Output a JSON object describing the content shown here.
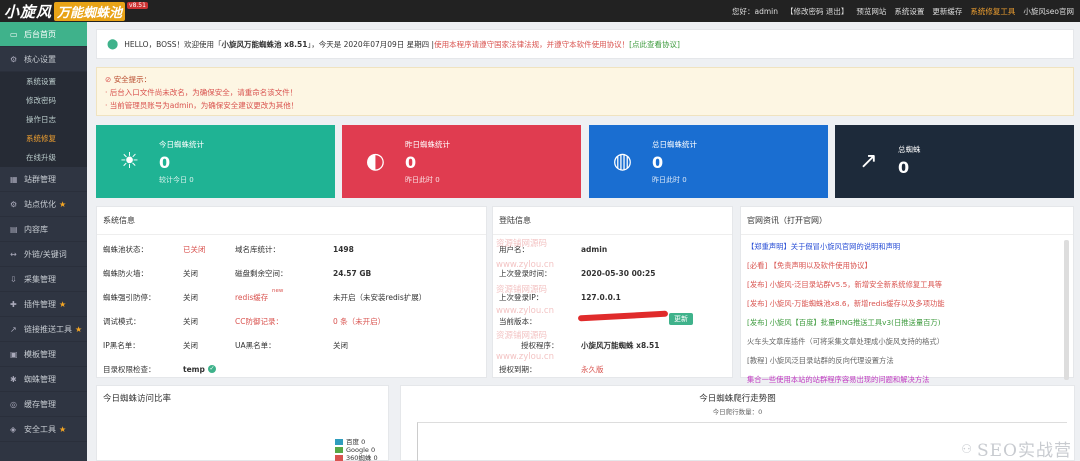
{
  "app": {
    "logo_main": "小旋风",
    "logo_badge": "万能蜘蛛池",
    "logo_version": "v8.51"
  },
  "topbar": {
    "links": [
      {
        "label": "您好：admin"
      },
      {
        "label": "【修改密码 退出】"
      },
      {
        "label": "预览网站"
      },
      {
        "label": "系统设置"
      },
      {
        "label": "更新缓存"
      },
      {
        "label": "系统修复工具",
        "highlight": true
      },
      {
        "label": "小旋风seo官网"
      }
    ]
  },
  "sidebar": {
    "items": [
      {
        "label": "后台首页",
        "icon": "home-icon",
        "glyph": "▭",
        "active": true
      },
      {
        "label": "核心设置",
        "icon": "gear-icon",
        "glyph": "⚙",
        "expanded": true,
        "children": [
          {
            "label": "系统设置"
          },
          {
            "label": "修改密码"
          },
          {
            "label": "操作日志"
          },
          {
            "label": "系统修复",
            "active": true
          },
          {
            "label": "在线升级"
          }
        ]
      },
      {
        "label": "站群管理",
        "icon": "sites-icon",
        "glyph": "▦"
      },
      {
        "label": "站点优化",
        "icon": "optimize-icon",
        "glyph": "⚙",
        "star": true
      },
      {
        "label": "内容库",
        "icon": "database-icon",
        "glyph": "▤"
      },
      {
        "label": "外链/关键词",
        "icon": "link-icon",
        "glyph": "↔"
      },
      {
        "label": "采集管理",
        "icon": "collect-icon",
        "glyph": "⇩"
      },
      {
        "label": "插件管理",
        "icon": "plugin-icon",
        "glyph": "✚",
        "star": true
      },
      {
        "label": "链接推送工具",
        "icon": "push-icon",
        "glyph": "↗",
        "star": true
      },
      {
        "label": "模板管理",
        "icon": "template-icon",
        "glyph": "▣"
      },
      {
        "label": "蜘蛛管理",
        "icon": "spider-icon",
        "glyph": "✱"
      },
      {
        "label": "缓存管理",
        "icon": "cache-icon",
        "glyph": "◎"
      },
      {
        "label": "安全工具",
        "icon": "shield-icon",
        "glyph": "◈",
        "star": true
      }
    ]
  },
  "welcome": {
    "prefix": "HELLO，BOSS！欢迎使用「",
    "product": "小旋风万能蜘蛛池 x8.51",
    "middle": "」，今天是 2020年07月09日 星期四 | ",
    "warning": "使用本程序请遵守国家法律法规，并遵守本软件使用协议！",
    "link": "[点此查看协议]"
  },
  "alert": {
    "title": "安全提示：",
    "lines": [
      "· 后台入口文件尚未改名，为确保安全，请重命名该文件！",
      "· 当前管理员账号为admin，为确保安全建议更改为其他！"
    ]
  },
  "stats": [
    {
      "title": "今日蜘蛛统计",
      "value": "0",
      "sub": "较计今日 0",
      "color": "#1fb394",
      "icon": "sun-icon",
      "glyph": "☀"
    },
    {
      "title": "昨日蜘蛛统计",
      "value": "0",
      "sub": "昨日此时 0",
      "color": "#e03c50",
      "icon": "contrast-icon",
      "glyph": "◐"
    },
    {
      "title": "总日蜘蛛统计",
      "value": "0",
      "sub": "昨日此时 0",
      "color": "#1a6ed1",
      "icon": "globe-icon",
      "glyph": "◍"
    },
    {
      "title": "总蜘蛛",
      "value": "0",
      "sub": "",
      "color": "#1d2a3a",
      "icon": "trend-icon",
      "glyph": "↗"
    }
  ],
  "system": {
    "title": "系统信息",
    "rows": [
      {
        "l1": "蜘蛛池状态：",
        "v1": "已关闭",
        "v1red": true,
        "l2": "域名库统计：",
        "v2": "1498"
      },
      {
        "l1": "蜘蛛防火墙：",
        "v1": "关闭",
        "l2": "磁盘剩余空间：",
        "v2": "24.57 GB"
      },
      {
        "l1": "蜘蛛强引防停：",
        "v1": "关闭",
        "l2": "redis缓存",
        "l2new": "new",
        "v2": "未开启（未安装redis扩展）"
      },
      {
        "l1": "调试模式：",
        "v1": "关闭",
        "l2": "CC防御记录：",
        "v2": "0 条（未开启）",
        "v2red": true
      },
      {
        "l1": "IP黑名单：",
        "v1": "关闭",
        "l2": "UA黑名单：",
        "v2": "关闭"
      },
      {
        "l1": "目录权限检查：",
        "v1": "temp"
      }
    ]
  },
  "login": {
    "title": "登陆信息",
    "rows": [
      {
        "label": "用户名：",
        "value": "admin"
      },
      {
        "label": "上次登录时间：",
        "value": "2020-05-30 00:25"
      },
      {
        "label": "上次登录IP：",
        "value": "127.0.0.1"
      },
      {
        "label": "当前版本：",
        "value": "",
        "button": "更新"
      },
      {
        "label": "授权程序：",
        "value": "小旋风万能蜘蛛 x8.51"
      },
      {
        "label": "授权到期：",
        "value": "永久版"
      }
    ],
    "watermark": [
      "资源铺网源码",
      "www.zylou.cn"
    ]
  },
  "news": {
    "title": "官网资讯（打开官网）",
    "items": [
      {
        "text": "【郑重声明】关于假冒小旋风官网的说明和声明",
        "color": "#2a4fd6"
      },
      {
        "text": "[必看] 【免责声明以及软件使用协议】",
        "color": "#d9534f"
      },
      {
        "text": "[发布] 小旋风-泛目录站群V5.5，新增安全新系统修复工具等",
        "color": "#d9534f"
      },
      {
        "text": "[发布] 小旋风-万能蜘蛛池x8.6，新增redis缓存以及多项功能",
        "color": "#d9534f"
      },
      {
        "text": "[发布] 小旋风【百度】批量PING推送工具v3(日推送量百万)",
        "color": "#3c9a3c"
      },
      {
        "text": "火车头文章库插件（可将采集文章处理成小旋风支持的格式）",
        "color": "#666"
      },
      {
        "text": "[教程] 小旋风泛目录站群的反向代理设置方法",
        "color": "#666"
      },
      {
        "text": "集合一些使用本站的站群程序容易出现的问题和解决方法",
        "color": "#c23ac2"
      }
    ]
  },
  "bottom_left": {
    "title": "今日蜘蛛访问比率",
    "legend": [
      {
        "label": "百度 0",
        "color": "#2f9dbd"
      },
      {
        "label": "Google 0",
        "color": "#57a846"
      },
      {
        "label": "360蜘蛛 0",
        "color": "#d9534f"
      }
    ]
  },
  "bottom_right": {
    "title": "今日蜘蛛爬行走势图",
    "subtitle": "今日爬行数量：0"
  },
  "signature": "SEO实战营"
}
